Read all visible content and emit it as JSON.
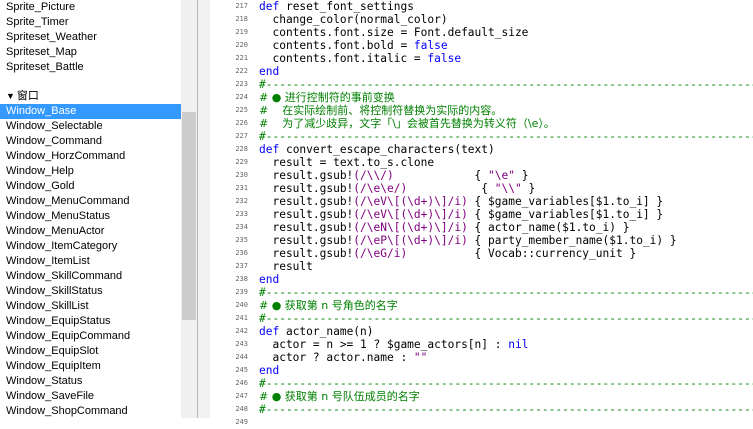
{
  "sidebar": {
    "items_top": [
      "Sprite_Picture",
      "Sprite_Timer",
      "Spriteset_Weather",
      "Spriteset_Map",
      "Spriteset_Battle"
    ],
    "section_label": "窗口",
    "items": [
      "Window_Base",
      "Window_Selectable",
      "Window_Command",
      "Window_HorzCommand",
      "Window_Help",
      "Window_Gold",
      "Window_MenuCommand",
      "Window_MenuStatus",
      "Window_MenuActor",
      "Window_ItemCategory",
      "Window_ItemList",
      "Window_SkillCommand",
      "Window_SkillStatus",
      "Window_SkillList",
      "Window_EquipStatus",
      "Window_EquipCommand",
      "Window_EquipSlot",
      "Window_EquipItem",
      "Window_Status",
      "Window_SaveFile",
      "Window_ShopCommand"
    ],
    "selected": "Window_Base"
  },
  "editor": {
    "line_numbers": [
      "217",
      "218",
      "219",
      "220",
      "221",
      "222",
      "223",
      "224",
      "225",
      "226",
      "227",
      "228",
      "229",
      "230",
      "231",
      "232",
      "233",
      "234",
      "235",
      "236",
      "237",
      "238",
      "239",
      "240",
      "241",
      "242",
      "243",
      "244",
      "245",
      "246",
      "247",
      "248",
      "249"
    ],
    "separator": "#--------------------------------------------------------------------------",
    "lines": {
      "l217_kw": "def",
      "l217_rest": " reset_font_settings",
      "l218": "  change_color(normal_color)",
      "l219": "  contents.font.size = Font.default_size",
      "l220_a": "  contents.font.bold = ",
      "l220_b": "false",
      "l221_a": "  contents.font.italic = ",
      "l221_b": "false",
      "l222": "end",
      "l224": "# ● 进行控制符的事前变换",
      "l225": "#    在实际绘制前、将控制符替换为实际的内容。",
      "l226": "#    为了减少歧异，文字「\\」会被首先替换为转义符（\\e）。",
      "l228_kw": "def",
      "l228_rest": " convert_escape_characters(text)",
      "l229": "  result = text.to_s.clone",
      "l230_a": "  result.gsub!",
      "l230_re": "(/\\\\/)",
      "l230_pad": "            { ",
      "l230_st": "\"\\e\"",
      "l230_end": " }",
      "l231_a": "  result.gsub!",
      "l231_re": "(/\\e\\e/)",
      "l231_pad": "           { ",
      "l231_st": "\"\\\\\"",
      "l231_end": " }",
      "l232_a": "  result.gsub!",
      "l232_re": "(/\\eV\\[(\\d+)\\]/i)",
      "l232_b": " { $game_variables[$1.to_i] }",
      "l233_a": "  result.gsub!",
      "l233_re": "(/\\eV\\[(\\d+)\\]/i)",
      "l233_b": " { $game_variables[$1.to_i] }",
      "l234_a": "  result.gsub!",
      "l234_re": "(/\\eN\\[(\\d+)\\]/i)",
      "l234_b": " { actor_name($1.to_i) }",
      "l235_a": "  result.gsub!",
      "l235_re": "(/\\eP\\[(\\d+)\\]/i)",
      "l235_b": " { party_member_name($1.to_i) }",
      "l236_a": "  result.gsub!",
      "l236_re": "(/\\eG/i)",
      "l236_b": "          { Vocab::currency_unit }",
      "l237": "  result",
      "l238": "end",
      "l240": "# ● 获取第 n 号角色的名字",
      "l242_kw": "def",
      "l242_rest": " actor_name(n)",
      "l243_a": "  actor = n >= 1 ? $game_actors[n] : ",
      "l243_b": "nil",
      "l244_a": "  actor ? actor.name : ",
      "l244_b": "\"\"",
      "l245": "end",
      "l247": "# ● 获取第 n 号队伍成员的名字"
    }
  }
}
